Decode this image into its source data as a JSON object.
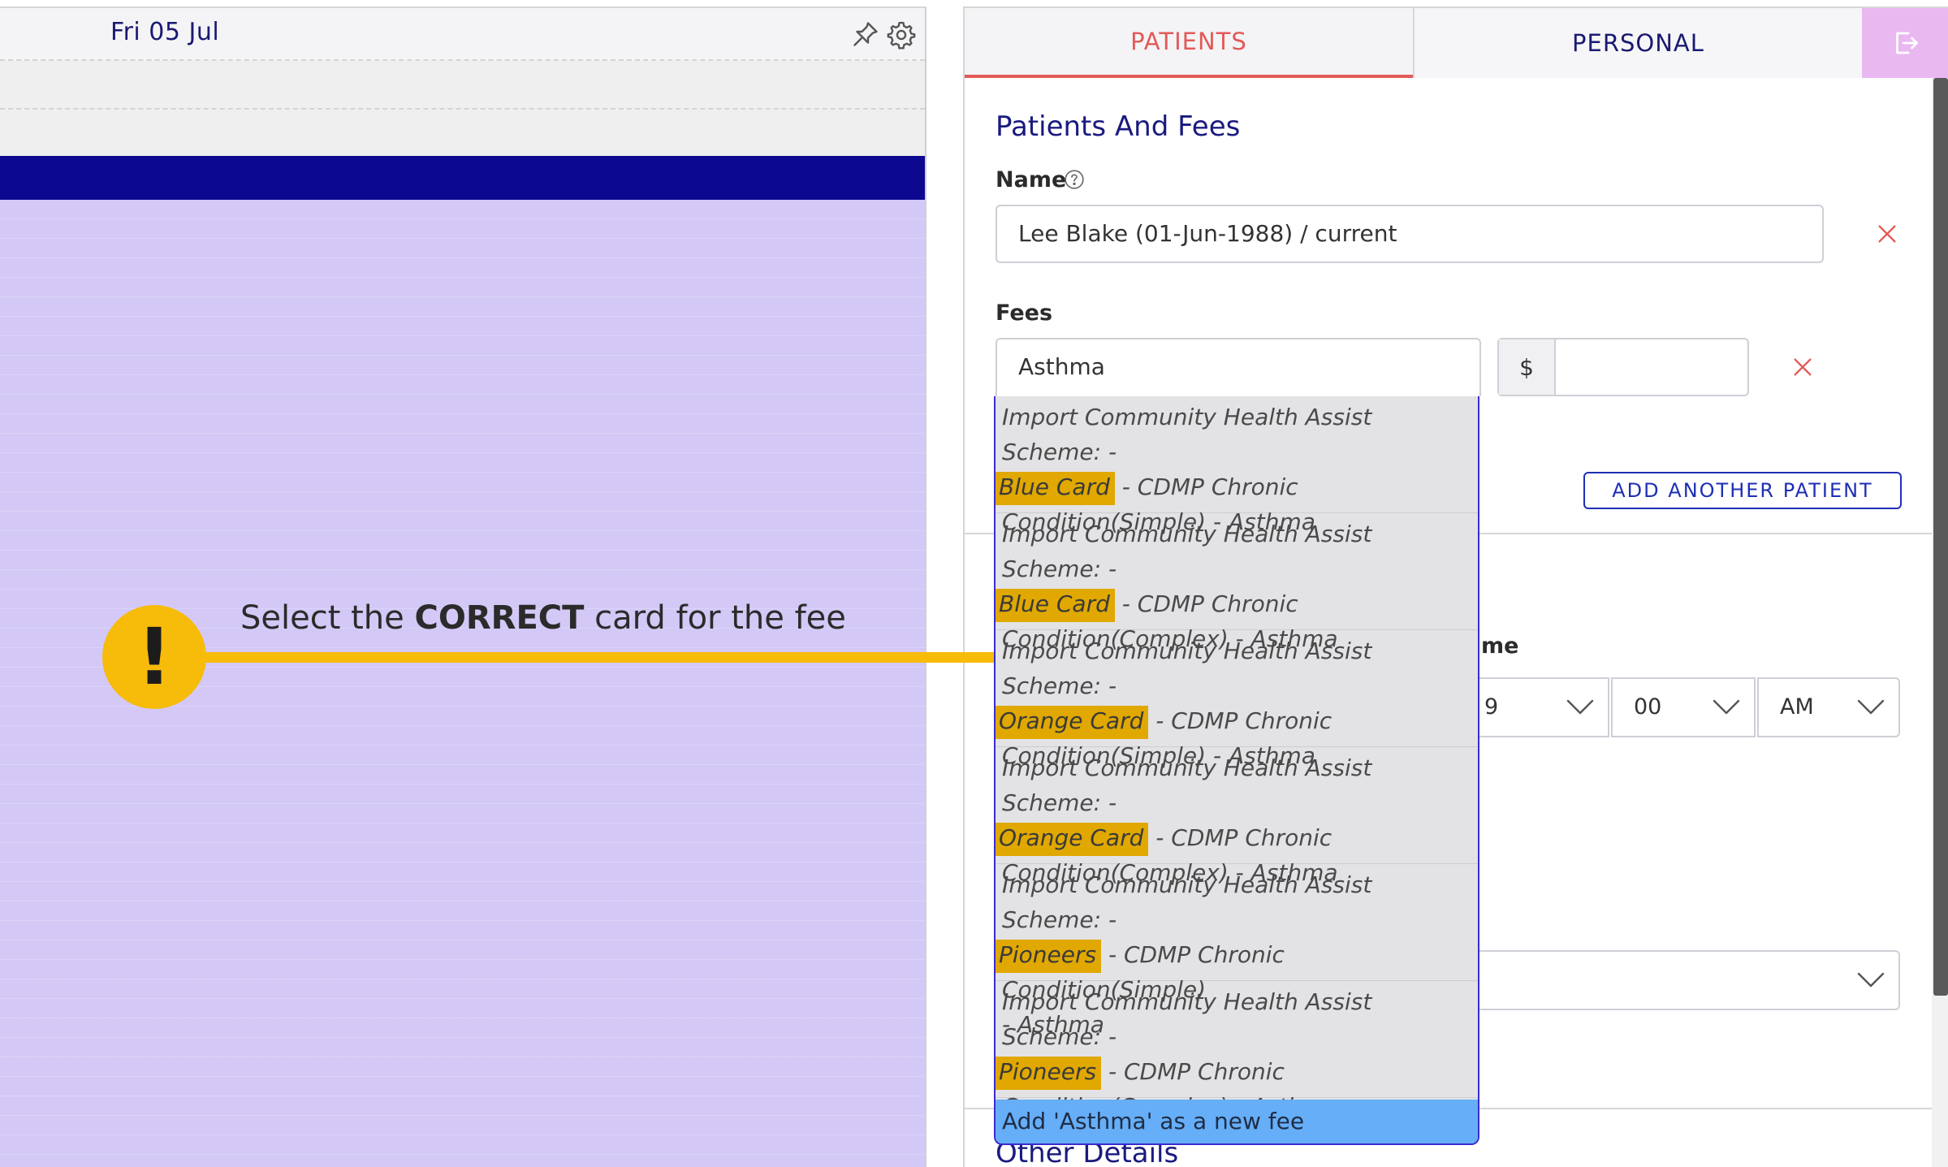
{
  "calendar": {
    "date_label": "Fri 05 Jul",
    "pin_icon": "pin-icon",
    "settings_icon": "gear-icon",
    "nav_bar_color": "#0c0890",
    "grid_color": "#d3c8f6"
  },
  "tabs": [
    {
      "label": "PATIENTS",
      "active": true
    },
    {
      "label": "PERSONAL",
      "active": false
    }
  ],
  "exit_icon": "exit-icon",
  "form": {
    "section_title": "Patients And Fees",
    "name_label": "Name",
    "name_value": "Lee Blake (01-Jun-1988) / current",
    "fees_label": "Fees",
    "fee_search_value": "Asthma",
    "currency_symbol": "$",
    "amount_value": "",
    "add_patient_label": "ADD ANOTHER PATIENT",
    "time_label_fragment": "me",
    "hour_value": "9",
    "minute_value": "00",
    "ampm_value": "AM",
    "other_details_title": "Other Details"
  },
  "dropdown": {
    "options": [
      {
        "prefix": "Import Community Health Assist Scheme: -",
        "card": "Blue Card",
        "suffix_line1": "- CDMP Chronic",
        "line3": "Condition(Simple) - Asthma"
      },
      {
        "prefix": "Import Community Health Assist Scheme: -",
        "card": "Blue Card",
        "suffix_line1": "- CDMP Chronic",
        "line3": "Condition(Complex) - Asthma"
      },
      {
        "prefix": "Import Community Health Assist Scheme: -",
        "card": "Orange Card",
        "suffix_line1": "- CDMP Chronic",
        "line3": "Condition(Simple) - Asthma"
      },
      {
        "prefix": "Import Community Health Assist Scheme: -",
        "card": "Orange Card",
        "suffix_line1": "- CDMP Chronic",
        "line3": "Condition(Complex) - Asthma"
      },
      {
        "prefix": "Import Community Health Assist Scheme: -",
        "card": "Pioneers",
        "suffix_line1": "- CDMP Chronic Condition(Simple)",
        "line3": "- Asthma"
      },
      {
        "prefix": "Import Community Health Assist Scheme: -",
        "card": "Pioneers",
        "suffix_line1": "- CDMP Chronic",
        "line3": "Condition(Complex) - Asthma"
      }
    ],
    "add_new_label": "Add 'Asthma' as a new fee",
    "highlight_color": "#e0a800",
    "add_new_color": "#66aef7"
  },
  "callout": {
    "icon": "exclamation-icon",
    "text_before": "Select the ",
    "text_bold": "CORRECT",
    "text_after": " card for the fee",
    "color": "#f7bb0a"
  }
}
